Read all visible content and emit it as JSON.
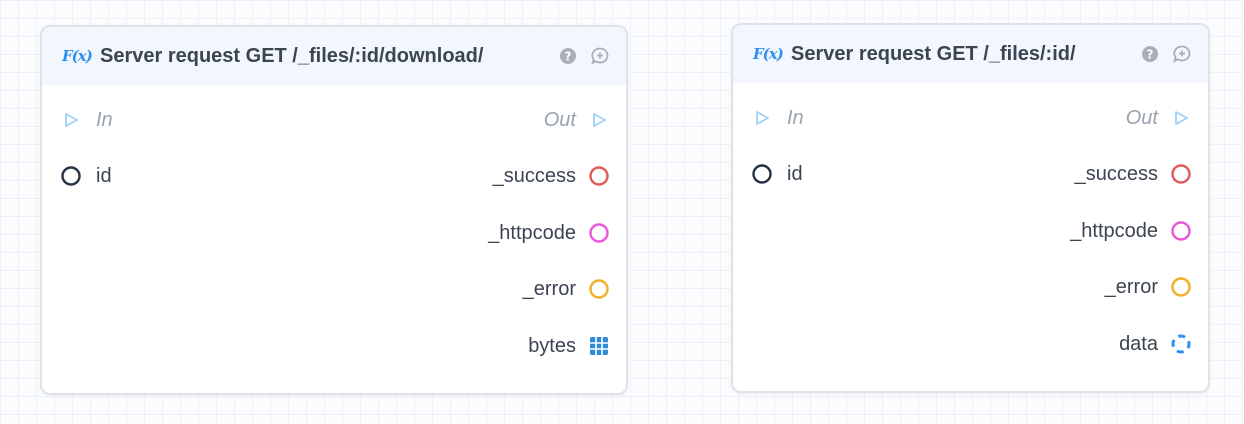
{
  "nodes": [
    {
      "title": "Server request GET /_files/:id/download/",
      "fx_label": "F(x)",
      "in_label": "In",
      "out_label": "Out",
      "inputs": [
        {
          "label": "id",
          "color": "#263244"
        }
      ],
      "outputs": [
        {
          "label": "_success",
          "color": "#e05a5a",
          "icon": "circle-port-icon"
        },
        {
          "label": "_httpcode",
          "color": "#e957d8",
          "icon": "circle-port-icon"
        },
        {
          "label": "_error",
          "color": "#f0b02a",
          "icon": "circle-port-icon"
        },
        {
          "label": "bytes",
          "color": "#2f8ad8",
          "icon": "grid-port-icon"
        }
      ]
    },
    {
      "title": "Server request GET /_files/:id/",
      "fx_label": "F(x)",
      "in_label": "In",
      "out_label": "Out",
      "inputs": [
        {
          "label": "id",
          "color": "#263244"
        }
      ],
      "outputs": [
        {
          "label": "_success",
          "color": "#e05a5a",
          "icon": "circle-port-icon"
        },
        {
          "label": "_httpcode",
          "color": "#e957d8",
          "icon": "circle-port-icon"
        },
        {
          "label": "_error",
          "color": "#f0b02a",
          "icon": "circle-port-icon"
        },
        {
          "label": "data",
          "color": "#2f8ff0",
          "icon": "dashed-circle-port-icon"
        }
      ]
    }
  ],
  "colors": {
    "exec": "#9fd0f5",
    "header_bg": "#f1f7fd",
    "accent": "#2f8ff0",
    "header_icons": "#a8afb8"
  }
}
